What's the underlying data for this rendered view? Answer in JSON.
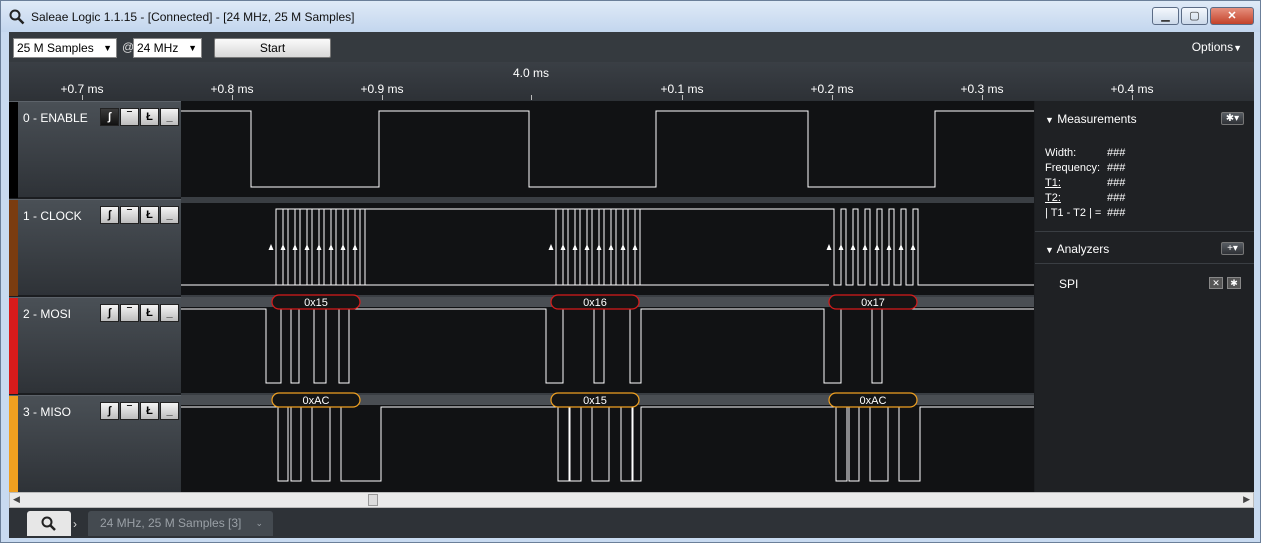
{
  "window": {
    "title": "Saleae Logic 1.1.15 - [Connected] - [24 MHz, 25 M Samples]",
    "min_label": "▁",
    "max_label": "▢",
    "close_label": "✕"
  },
  "toolbar": {
    "samples_value": "25 M Samples",
    "at_label": "@",
    "rate_value": "24 MHz",
    "start_label": "Start",
    "options_label": "Options"
  },
  "timescale": {
    "center_label": "4.0 ms",
    "ticks": [
      "+0.7 ms",
      "+0.8 ms",
      "+0.9 ms",
      "+0.1 ms",
      "+0.2 ms",
      "+0.3 ms",
      "+0.4 ms"
    ]
  },
  "channels": [
    {
      "label": "0 - ENABLE",
      "color": "#000000"
    },
    {
      "label": "1 - CLOCK",
      "color": "#7a3c10"
    },
    {
      "label": "2 - MOSI",
      "color": "#d81b1b"
    },
    {
      "label": "3 - MISO",
      "color": "#f0a020"
    }
  ],
  "decodes": {
    "mosi": [
      "0x15",
      "0x16",
      "0x17"
    ],
    "miso": [
      "0xAC",
      "0x15",
      "0xAC"
    ]
  },
  "measurements": {
    "title": "Measurements",
    "rows": [
      {
        "label": "Width:",
        "value": "###"
      },
      {
        "label": "Frequency:",
        "value": "###"
      },
      {
        "label": "T1:",
        "value": "###"
      },
      {
        "label": "T2:",
        "value": "###"
      },
      {
        "label": "| T1 - T2 | =",
        "value": "###"
      }
    ]
  },
  "analyzers": {
    "title": "Analyzers",
    "items": [
      "SPI"
    ]
  },
  "tabs": {
    "session_label": "24 MHz, 25 M Samples [3]"
  },
  "colors": {
    "mosi_decode": "#d81b1b",
    "miso_decode": "#f0a020",
    "signal": "#ffffff"
  }
}
